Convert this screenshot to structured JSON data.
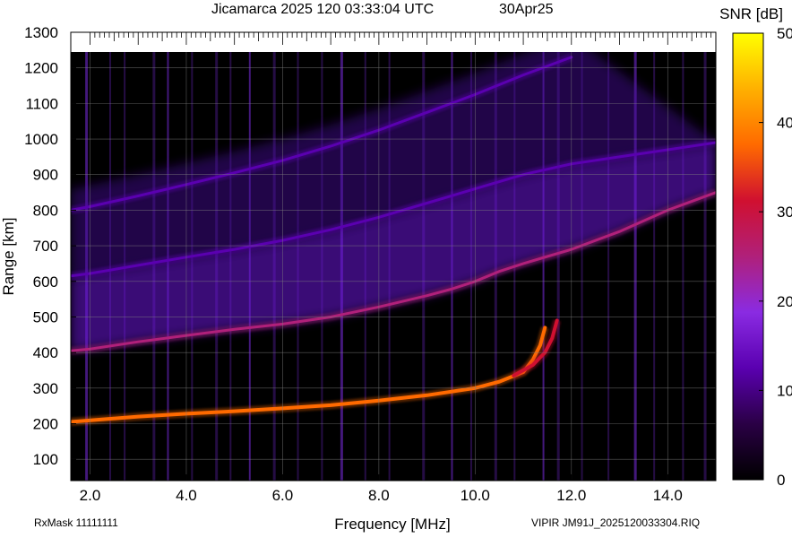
{
  "header": {
    "title": "Jicamarca 2025 120 03:33:04 UTC",
    "date": "30Apr25"
  },
  "footer": {
    "rx_mask": "RxMask 11111111",
    "file": "VIPIR  JM91J_2025120033304.RIQ"
  },
  "colors": {
    "background": "#000000",
    "grid": "#808080",
    "colormap": [
      "#000000",
      "#2a0045",
      "#5a00b0",
      "#8a2be2",
      "#b0207a",
      "#d01030",
      "#ff6a00",
      "#ffb000",
      "#ffff00"
    ]
  },
  "chart_data": {
    "type": "heatmap",
    "title": "Jicamarca 2025 120 03:33:04 UTC",
    "xlabel": "Frequency [MHz]",
    "ylabel": "Range [km]",
    "xlim": [
      1.6,
      15.0
    ],
    "ylim": [
      40,
      1300
    ],
    "grid": true,
    "x_ticks": [
      2.0,
      4.0,
      6.0,
      8.0,
      10.0,
      12.0,
      14.0
    ],
    "x_tick_labels": [
      "2.0",
      "4.0",
      "6.0",
      "8.0",
      "10.0",
      "12.0",
      "14.0"
    ],
    "y_ticks": [
      100,
      200,
      300,
      400,
      500,
      600,
      700,
      800,
      900,
      1000,
      1100,
      1200,
      1300
    ],
    "y_tick_labels": [
      "100",
      "200",
      "300",
      "400",
      "500",
      "600",
      "700",
      "800",
      "900",
      "1000",
      "1100",
      "1200",
      "1300"
    ],
    "colorbar": {
      "label": "SNR [dB]",
      "range": [
        0,
        50
      ],
      "ticks": [
        0,
        10,
        20,
        30,
        40,
        50
      ],
      "tick_labels": [
        "0",
        "10",
        "20",
        "30",
        "40",
        "50"
      ]
    },
    "traces": [
      {
        "description_id": "f-layer-first-hop",
        "snr_db": 40,
        "points": [
          [
            1.6,
            205
          ],
          [
            3.0,
            220
          ],
          [
            4.0,
            228
          ],
          [
            5.0,
            235
          ],
          [
            6.0,
            243
          ],
          [
            7.0,
            252
          ],
          [
            8.0,
            265
          ],
          [
            9.0,
            280
          ],
          [
            10.0,
            300
          ],
          [
            10.5,
            318
          ],
          [
            11.0,
            345
          ],
          [
            11.2,
            380
          ],
          [
            11.35,
            420
          ],
          [
            11.45,
            470
          ]
        ]
      },
      {
        "description_id": "f-layer-x-mode",
        "snr_db": 30,
        "points": [
          [
            10.8,
            335
          ],
          [
            11.2,
            365
          ],
          [
            11.45,
            400
          ],
          [
            11.6,
            440
          ],
          [
            11.7,
            490
          ]
        ]
      },
      {
        "description_id": "second-hop-lower-edge",
        "snr_db": 25,
        "points": [
          [
            1.6,
            405
          ],
          [
            2.0,
            410
          ],
          [
            3.0,
            430
          ],
          [
            4.0,
            448
          ],
          [
            5.0,
            465
          ],
          [
            6.0,
            480
          ],
          [
            7.0,
            500
          ],
          [
            8.0,
            528
          ],
          [
            9.0,
            560
          ],
          [
            9.5,
            578
          ],
          [
            10.0,
            600
          ],
          [
            10.5,
            628
          ],
          [
            11.0,
            650
          ],
          [
            11.5,
            670
          ],
          [
            12.0,
            690
          ],
          [
            13.0,
            740
          ],
          [
            14.0,
            800
          ],
          [
            15.0,
            850
          ]
        ]
      },
      {
        "description_id": "second-hop-upper-edge",
        "snr_db": 15,
        "points": [
          [
            1.6,
            615
          ],
          [
            2.0,
            622
          ],
          [
            3.0,
            645
          ],
          [
            4.0,
            668
          ],
          [
            5.0,
            690
          ],
          [
            6.0,
            715
          ],
          [
            7.0,
            745
          ],
          [
            8.0,
            780
          ],
          [
            9.0,
            820
          ],
          [
            10.0,
            860
          ],
          [
            11.0,
            900
          ],
          [
            12.0,
            930
          ],
          [
            13.0,
            950
          ],
          [
            14.0,
            970
          ],
          [
            15.0,
            990
          ]
        ]
      },
      {
        "description_id": "third-hop-edge",
        "snr_db": 12,
        "points": [
          [
            1.6,
            800
          ],
          [
            2.0,
            810
          ],
          [
            3.0,
            840
          ],
          [
            4.0,
            872
          ],
          [
            5.0,
            905
          ],
          [
            6.0,
            940
          ],
          [
            7.0,
            980
          ],
          [
            8.0,
            1025
          ],
          [
            9.0,
            1075
          ],
          [
            10.0,
            1125
          ],
          [
            11.0,
            1180
          ],
          [
            12.0,
            1230
          ]
        ]
      }
    ],
    "vertical_interference_mhz": [
      1.9,
      2.4,
      2.7,
      3.3,
      3.6,
      4.1,
      4.6,
      4.9,
      5.3,
      5.8,
      6.3,
      6.8,
      7.2,
      7.7,
      8.2,
      8.9,
      9.5,
      9.9,
      10.4,
      10.8,
      11.4,
      11.7,
      12.2,
      12.75,
      13.3,
      13.7,
      14.3,
      14.75
    ]
  }
}
